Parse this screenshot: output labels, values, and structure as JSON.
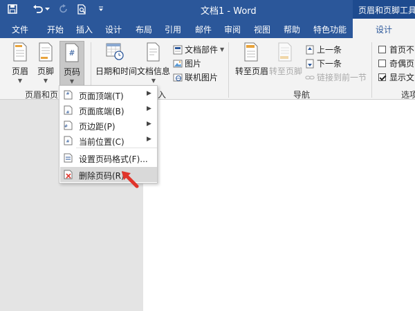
{
  "titlebar": {
    "doc_title": "文档1 - Word",
    "context_title": "页眉和页脚工具",
    "colors": {
      "bar": "#2b579a",
      "context": "#1e4b8f"
    }
  },
  "tabs": [
    {
      "label": "文件"
    },
    {
      "label": "开始"
    },
    {
      "label": "插入"
    },
    {
      "label": "设计"
    },
    {
      "label": "布局"
    },
    {
      "label": "引用"
    },
    {
      "label": "邮件"
    },
    {
      "label": "审阅"
    },
    {
      "label": "视图"
    },
    {
      "label": "帮助"
    },
    {
      "label": "特色功能"
    }
  ],
  "active_tab": {
    "label": "设计"
  },
  "ribbon": {
    "header_btn": "页眉",
    "footer_btn": "页脚",
    "pagenum_btn": "页码",
    "datetime_btn": "日期和时间",
    "docinfo_btn": "文档信息",
    "quickparts": "文档部件",
    "picture": "图片",
    "online_picture": "联机图片",
    "goto_header": "转至页眉",
    "goto_footer": "转至页脚",
    "previous": "上一条",
    "next": "下一条",
    "link_previous": "链接到前一节",
    "first_page_diff": "首页不",
    "odd_even_diff": "奇偶页",
    "show_doc_text": "显示文",
    "group_header_footer": "页眉和页",
    "group_insert": "入",
    "group_nav": "导航",
    "group_options": "选项"
  },
  "menu": {
    "items": [
      {
        "label": "页面顶端(T)"
      },
      {
        "label": "页面底端(B)"
      },
      {
        "label": "页边距(P)"
      },
      {
        "label": "当前位置(C)"
      },
      {
        "label": "设置页码格式(F)..."
      },
      {
        "label": "删除页码(R)"
      }
    ],
    "highlight_color": "#d9d9d9"
  },
  "accent_red": "#e0342b"
}
